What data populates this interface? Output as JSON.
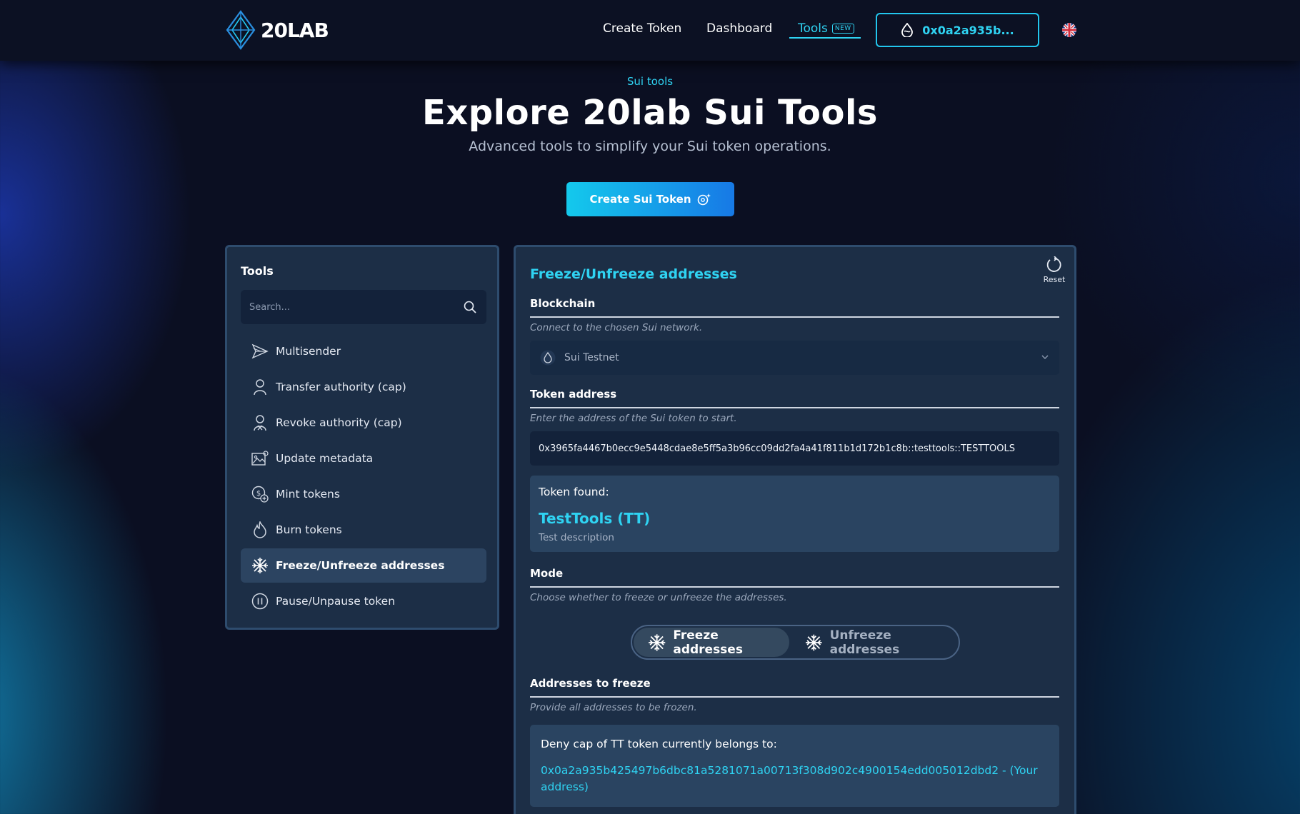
{
  "header": {
    "logo_text": "20LAB",
    "nav": {
      "create_token": "Create Token",
      "dashboard": "Dashboard",
      "tools": "Tools",
      "tools_badge": "NEW"
    },
    "wallet_address": "0x0a2a935b..."
  },
  "hero": {
    "eyebrow": "Sui tools",
    "title": "Explore 20lab Sui Tools",
    "subtitle": "Advanced tools to simplify your Sui token operations.",
    "cta_label": "Create Sui Token"
  },
  "sidebar": {
    "title": "Tools",
    "search_placeholder": "Search...",
    "items": [
      {
        "label": "Multisender",
        "icon": "send-icon"
      },
      {
        "label": "Transfer authority (cap)",
        "icon": "user-icon"
      },
      {
        "label": "Revoke authority (cap)",
        "icon": "user-revoke-icon"
      },
      {
        "label": "Update metadata",
        "icon": "image-edit-icon"
      },
      {
        "label": "Mint tokens",
        "icon": "coin-plus-icon"
      },
      {
        "label": "Burn tokens",
        "icon": "flame-icon"
      },
      {
        "label": "Freeze/Unfreeze addresses",
        "icon": "snowflake-icon",
        "active": true
      },
      {
        "label": "Pause/Unpause token",
        "icon": "pause-circle-icon"
      }
    ]
  },
  "panel": {
    "title": "Freeze/Unfreeze addresses",
    "reset_label": "Reset",
    "blockchain": {
      "label": "Blockchain",
      "hint": "Connect to the chosen Sui network.",
      "selected": "Sui Testnet"
    },
    "token_address": {
      "label": "Token address",
      "hint": "Enter the address of the Sui token to start.",
      "value": "0x3965fa4467b0ecc9e5448cdae8e5ff5a3b96cc09dd2fa4a41f811b1d172b1c8b::testtools::TESTTOOLS"
    },
    "token_card": {
      "found_label": "Token found:",
      "name": "TestTools (TT)",
      "description": "Test description"
    },
    "mode": {
      "label": "Mode",
      "hint": "Choose whether to freeze or unfreeze the addresses.",
      "freeze_label": "Freeze addresses",
      "unfreeze_label": "Unfreeze addresses",
      "selected": "freeze"
    },
    "addresses": {
      "label": "Addresses to freeze",
      "hint": "Provide all addresses to be frozen.",
      "deny_cap_label": "Deny cap of TT token currently belongs to:",
      "deny_cap_owner": "0x0a2a935b425497b6dbc81a5281071a00713f308d902c4900154edd005012dbd2 - (Your address)"
    }
  },
  "colors": {
    "accent": "#2fd3f2",
    "panel_bg": "#1c2e46",
    "page_bg": "#0b0f22"
  }
}
